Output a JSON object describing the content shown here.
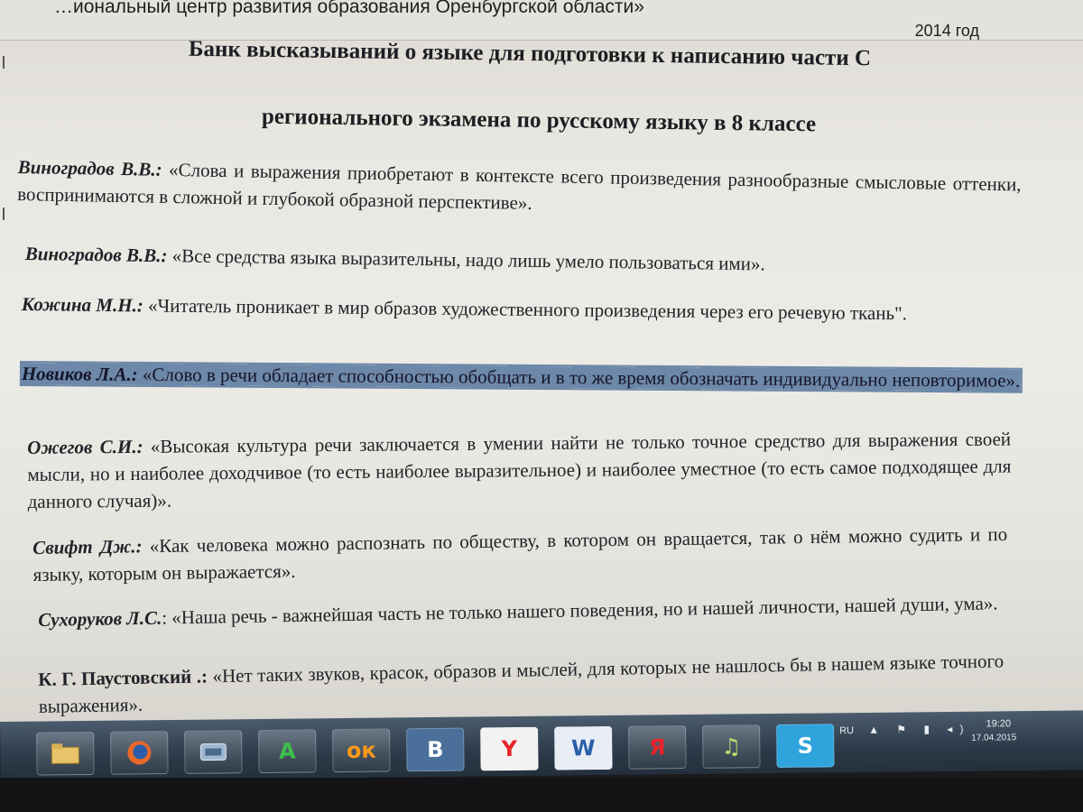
{
  "document": {
    "header_org": "…иональный центр развития образования Оренбургской области»",
    "header_year": "2014 год",
    "title_line1": "Банк высказываний о языке для подготовки к написанию части С",
    "title_line2": "регионального экзамена по русскому языку в 8 классе",
    "quotes": [
      {
        "author": "Виноградов   В.В.:",
        "text": " «Слова и выражения приобретают в контексте всего произведения разнообразные смысловые оттенки, воспринимаются в сложной и глубокой образной перспективе»."
      },
      {
        "author": "Виноградов В.В.:",
        "text": " «Все средства языка выразительны, надо лишь умело пользоваться ими»."
      },
      {
        "author": "Кожина   М.Н.:",
        "text": " «Читатель проникает в мир образов художественного произведения через его речевую ткань\"."
      },
      {
        "author": "Новиков  Л.А.:",
        "text": " «Слово в речи обладает способностью обобщать и в то же время обозначать индивидуально неповторимое»."
      },
      {
        "author": "Ожегов С.И.:",
        "text": " «Высокая культура речи заключается в умении найти не только точное средство для выражения своей мысли, но и наиболее доходчивое (то есть наиболее выразительное) и наиболее уместное (то есть самое подходящее для данного случая)»."
      },
      {
        "author": "Свифт Дж.:",
        "text": " «Как человека можно распознать по обществу, в котором он вращается, так о нём можно судить и по языку, которым он выражается»."
      },
      {
        "author": "Сухоруков Л.С.",
        "text": ": «Наша речь -  важнейшая часть не только нашего поведения, но и нашей личности, нашей души, ума»."
      },
      {
        "author": "К. Г. Паустовский .:",
        "text": " «Нет таких звуков, красок, образов и мыслей, для которых не нашлось бы в нашем языке точного выражения»."
      }
    ]
  },
  "taskbar": {
    "buttons": [
      {
        "icon": "file-explorer-icon",
        "label": ""
      },
      {
        "icon": "firefox-icon",
        "label": ""
      },
      {
        "icon": "network-app-icon",
        "label": ""
      },
      {
        "icon": "a-app-icon",
        "label": "A"
      },
      {
        "icon": "odnoklassniki-icon",
        "label": "ок"
      },
      {
        "icon": "vkontakte-icon",
        "label": "В"
      },
      {
        "icon": "yandex-browser-icon",
        "label": "Y"
      },
      {
        "icon": "word-icon",
        "label": "W"
      },
      {
        "icon": "yandex-icon",
        "label": "Я"
      },
      {
        "icon": "music-icon",
        "label": "♫"
      },
      {
        "icon": "skype-icon",
        "label": "S"
      }
    ],
    "tray": {
      "language": "RU",
      "time": "19:20",
      "date": "17.04.2015"
    }
  }
}
